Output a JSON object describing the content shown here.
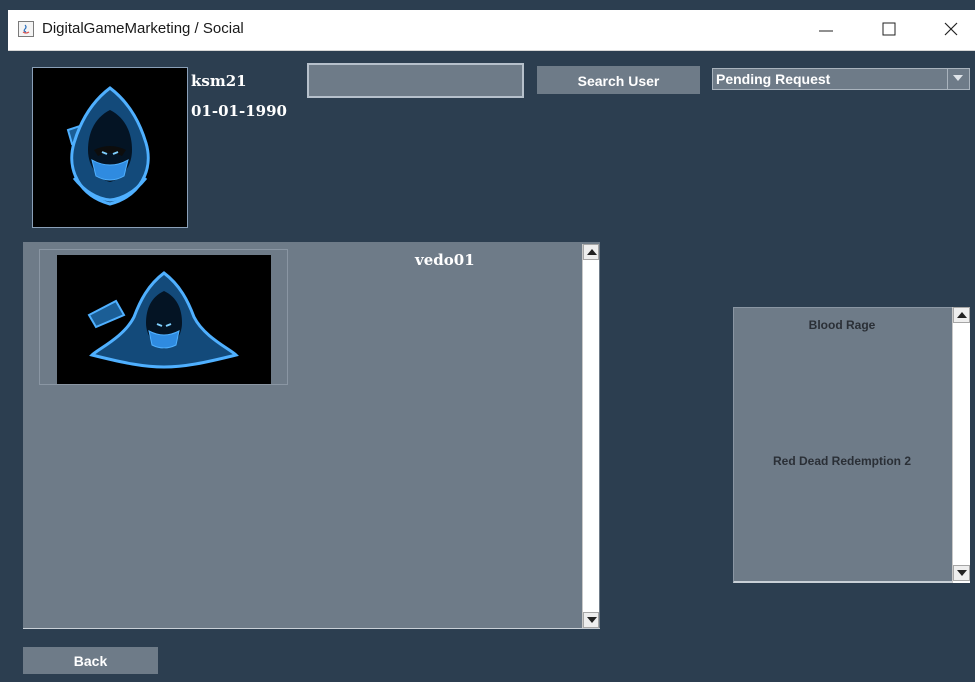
{
  "window": {
    "title": "DigitalGameMarketing / Social",
    "app_icon": "java-icon",
    "controls": [
      "minimize-icon",
      "maximize-icon",
      "close-icon"
    ]
  },
  "profile": {
    "username": "ksm21",
    "birthdate": "01-01-1990",
    "avatar_icon": "hooded-figure-avatar"
  },
  "search": {
    "value": "",
    "placeholder": "",
    "button_label": "Search User"
  },
  "request_filter": {
    "selected": "Pending Request"
  },
  "user_list": {
    "items": [
      {
        "username": "vedo01",
        "avatar_icon": "hooded-figure-avatar"
      }
    ]
  },
  "games": {
    "items": [
      "Blood Rage",
      "Red Dead Redemption 2"
    ]
  },
  "footer": {
    "back_label": "Back"
  },
  "colors": {
    "background": "#2c3e50",
    "panel": "#6e7b88",
    "avatar_blue": "#1f7fd8"
  }
}
